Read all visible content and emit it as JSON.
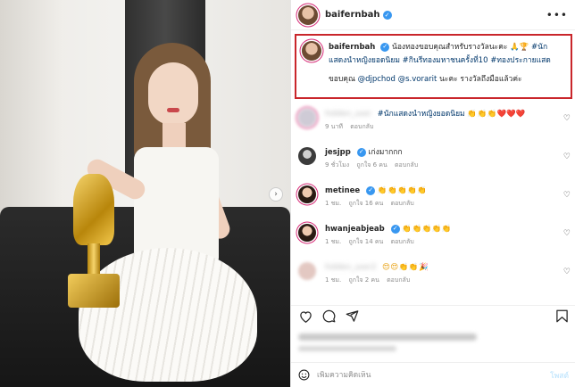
{
  "post": {
    "username": "baifernbah",
    "more_label": "•••"
  },
  "caption": {
    "username": "baifernbah",
    "text1": "น้องทองขอบคุณสำหรับรางวัลนะคะ 🙏🏆",
    "tags1": "#นักแสดงนำหญิงยอดนิยม #กินรีทองมหาชนครั้งที่10 #ทองประกายแสด",
    "text2": "ขอบคุณ",
    "mentions": "@djpchod @s.vorarit",
    "text3": "นะคะ รางวัลถึงมือแล้วค่ะ"
  },
  "comments": [
    {
      "username": "hidden_user",
      "tag": "#นักแสดงนำหญิงยอดนิยม",
      "text_y": "👏👏👏",
      "text_r": "❤️❤️❤️",
      "time": "9 นาที",
      "likes": "",
      "reply": "ตอบกลับ"
    },
    {
      "username": "jesjpp",
      "text": "เก่งมากกก",
      "time": "9 ชั่วโมง",
      "likes": "ถูกใจ 6 คน",
      "reply": "ตอบกลับ"
    },
    {
      "username": "metinee",
      "text": "👏👏👏👏👏",
      "time": "1 ชม.",
      "likes": "ถูกใจ 16 คน",
      "reply": "ตอบกลับ"
    },
    {
      "username": "hwanjeabjeab",
      "text": "👏👏👏👏👏",
      "time": "1 ชม.",
      "likes": "ถูกใจ 14 คน",
      "reply": "ตอบกลับ"
    },
    {
      "username": "hidden_user2",
      "text": "😍😍👏👏🎉",
      "time": "1 ชม.",
      "likes": "ถูกใจ 2 คน",
      "reply": "ตอบกลับ"
    }
  ],
  "add_comment": {
    "placeholder": "เพิ่มความคิดเห็น",
    "post_label": "โพสต์"
  },
  "icons": {
    "verified": "verified-icon",
    "heart": "heart-icon",
    "comment": "comment-icon",
    "share": "share-icon",
    "save": "bookmark-icon",
    "emoji": "emoji-icon",
    "next": "chevron-right-icon"
  },
  "colors": {
    "highlight_border": "#c9262b",
    "verified": "#3897f0",
    "hashtag": "#00376b"
  }
}
